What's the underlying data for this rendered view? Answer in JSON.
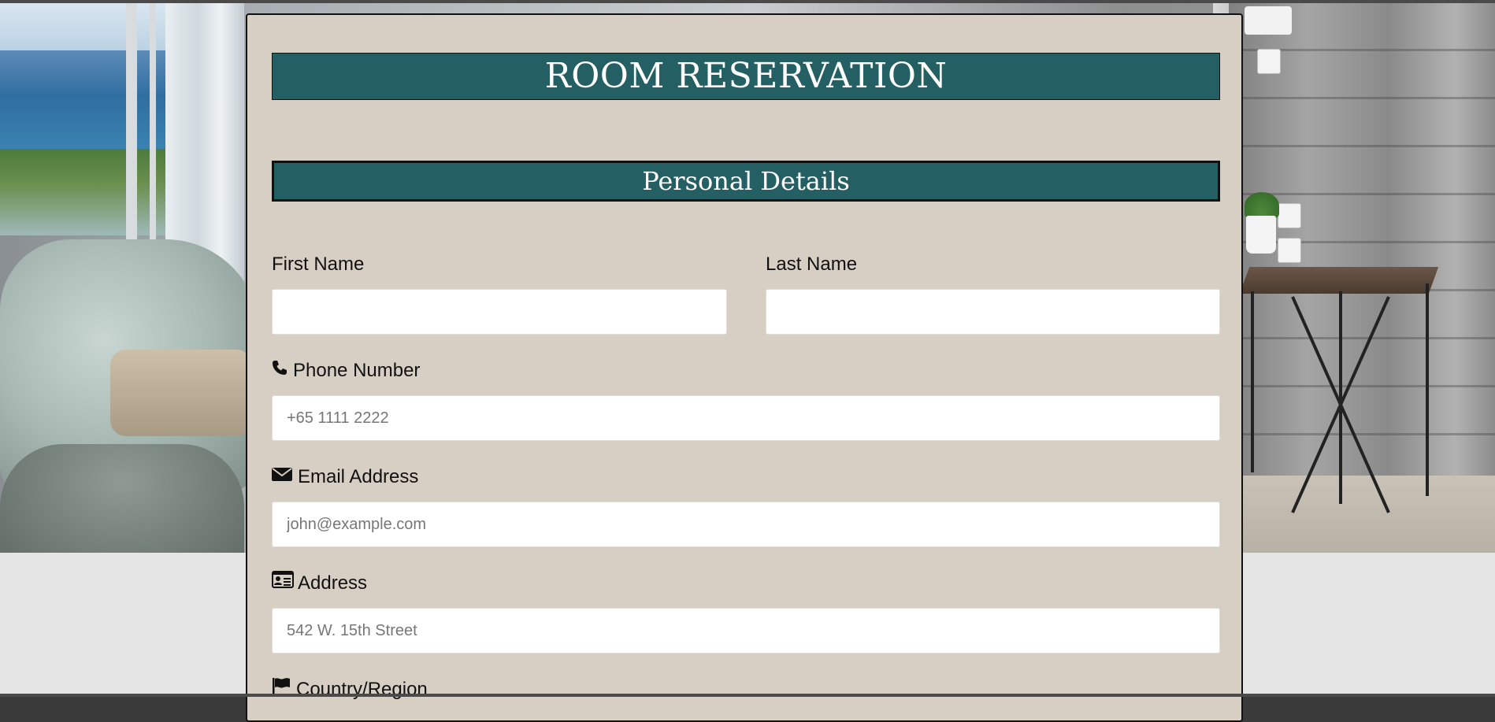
{
  "form": {
    "title": "ROOM RESERVATION",
    "section_title": "Personal Details",
    "first_name": {
      "label": "First Name",
      "value": "",
      "placeholder": ""
    },
    "last_name": {
      "label": "Last Name",
      "value": "",
      "placeholder": ""
    },
    "phone": {
      "label": "Phone Number",
      "icon": "phone-icon",
      "value": "",
      "placeholder": "+65 1111 2222"
    },
    "email": {
      "label": "Email Address",
      "icon": "envelope-icon",
      "value": "",
      "placeholder": "john@example.com"
    },
    "address": {
      "label": "Address",
      "icon": "id-card-icon",
      "value": "",
      "placeholder": "542 W. 15th Street"
    },
    "country": {
      "label": "Country/Region",
      "icon": "flag-icon"
    }
  },
  "colors": {
    "card_background": "#d8cfc4",
    "header_teal": "#245f63",
    "page_background": "#e5e5e5"
  }
}
